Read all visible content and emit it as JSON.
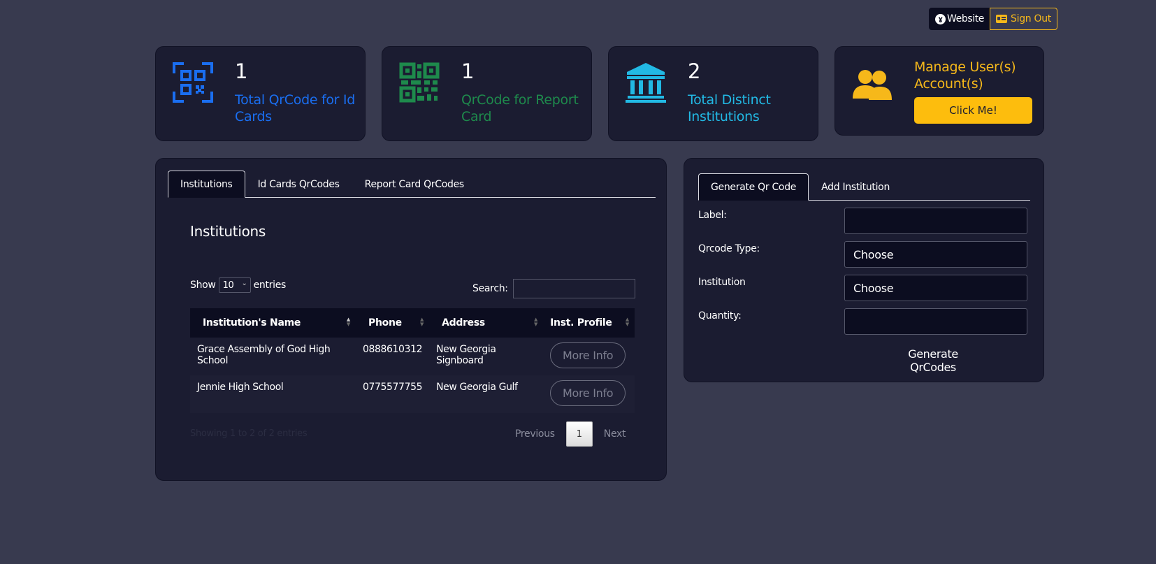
{
  "topbar": {
    "website_label": "Website",
    "signout_label": "Sign Out"
  },
  "stats": [
    {
      "value": "1",
      "label": "Total QrCode for Id Cards",
      "color": "#1a6ef0",
      "icon": "qr-scan-icon"
    },
    {
      "value": "1",
      "label": "QrCode for Report Card",
      "color": "#1e8a4c",
      "icon": "qr-code-icon"
    },
    {
      "value": "2",
      "label": "Total Distinct Institutions",
      "color": "#22b9e4",
      "icon": "institution-icon"
    }
  ],
  "manage": {
    "title": "Manage User(s) Account(s)",
    "button_label": "Click Me!",
    "color": "#f6b81a",
    "icon": "users-icon"
  },
  "left_panel": {
    "tabs": [
      "Institutions",
      "Id Cards QrCodes",
      "Report Card QrCodes"
    ],
    "active_tab": 0,
    "section_title": "Institutions",
    "show_label": "Show",
    "show_value": "10",
    "entries_label": "entries",
    "search_label": "Search:",
    "columns": [
      "Institution's Name",
      "Phone",
      "Address",
      "Inst. Profile"
    ],
    "rows": [
      {
        "name": "Grace Assembly of God High School",
        "phone": "0888610312",
        "address": "New Georgia Signboard",
        "action": "More Info"
      },
      {
        "name": "Jennie High School",
        "phone": "0775577755",
        "address": "New Georgia Gulf",
        "action": "More Info"
      }
    ],
    "info": "Showing 1 to 2 of 2 entries",
    "pager": {
      "previous": "Previous",
      "current": "1",
      "next": "Next"
    }
  },
  "right_panel": {
    "tabs": [
      "Generate Qr Code",
      "Add Institution"
    ],
    "active_tab": 0,
    "fields": [
      {
        "label": "Label:",
        "value": ""
      },
      {
        "label": "Qrcode Type:",
        "value": "Choose"
      },
      {
        "label": "Institution",
        "value": "Choose"
      },
      {
        "label": "Quantity:",
        "value": ""
      }
    ],
    "submit_label": "Generate QrCodes"
  }
}
